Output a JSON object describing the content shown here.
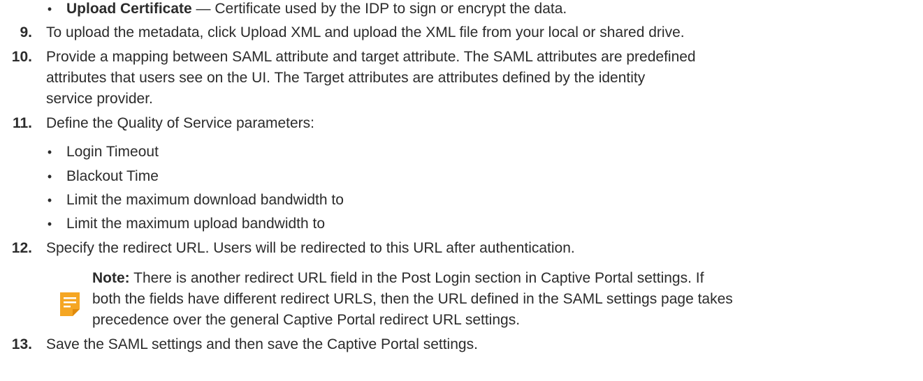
{
  "bullet_upload_cert": {
    "label": "Upload Certificate",
    "text": " — Certificate used by the IDP to sign or encrypt the data."
  },
  "steps": [
    {
      "number": "9.",
      "lines": [
        "To upload the metadata, click Upload XML and upload the XML file from your local or shared drive."
      ]
    },
    {
      "number": "10.",
      "lines": [
        "Provide a mapping between SAML attribute and target attribute. The SAML attributes are predefined",
        "attributes that users see on the UI. The Target attributes are attributes defined by the identity",
        "service provider."
      ]
    },
    {
      "number": "11.",
      "lines": [
        "Define the Quality of Service parameters:"
      ],
      "bullets": [
        "Login Timeout",
        "Blackout Time",
        "Limit the maximum download bandwidth to",
        "Limit the maximum upload bandwidth to"
      ]
    },
    {
      "number": "12.",
      "lines": [
        "Specify the redirect URL. Users will be redirected to this URL after authentication."
      ]
    },
    {
      "number": "13.",
      "lines": [
        "Save the SAML settings and then save the Captive Portal settings."
      ]
    }
  ],
  "note": {
    "label": "Note:",
    "lines": [
      " There is another redirect URL field in the Post Login section in Captive Portal settings. If",
      "both the fields have different redirect URLS, then the URL defined in the SAML settings page takes",
      "precedence over the general Captive Portal redirect URL settings."
    ],
    "icon": "note-icon",
    "icon_color": "#f5a623"
  }
}
